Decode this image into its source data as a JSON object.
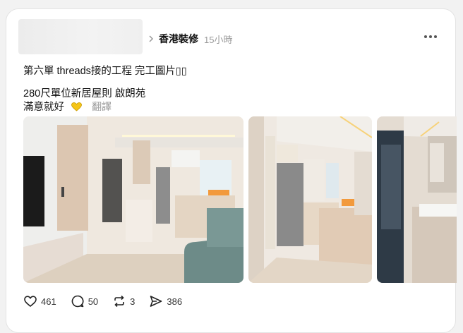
{
  "post": {
    "topic": "香港裝修",
    "time": "15小時",
    "line1": "第六單 threads接的工程 完工圖片▯▯",
    "line2": "280尺單位新居屋則 啟朗苑",
    "line3": "滿意就好",
    "translate_label": "翻譯"
  },
  "actions": {
    "likes": "461",
    "comments": "50",
    "reposts": "3",
    "shares": "386"
  },
  "icons": {
    "more": "more-dots-icon",
    "chevron": "chevron-right-icon",
    "like": "heart-icon",
    "comment": "comment-icon",
    "repost": "repost-icon",
    "share": "share-icon",
    "emoji": "yellow-heart-emoji"
  },
  "colors": {
    "accent": "#f5c518",
    "muted": "#999999"
  }
}
